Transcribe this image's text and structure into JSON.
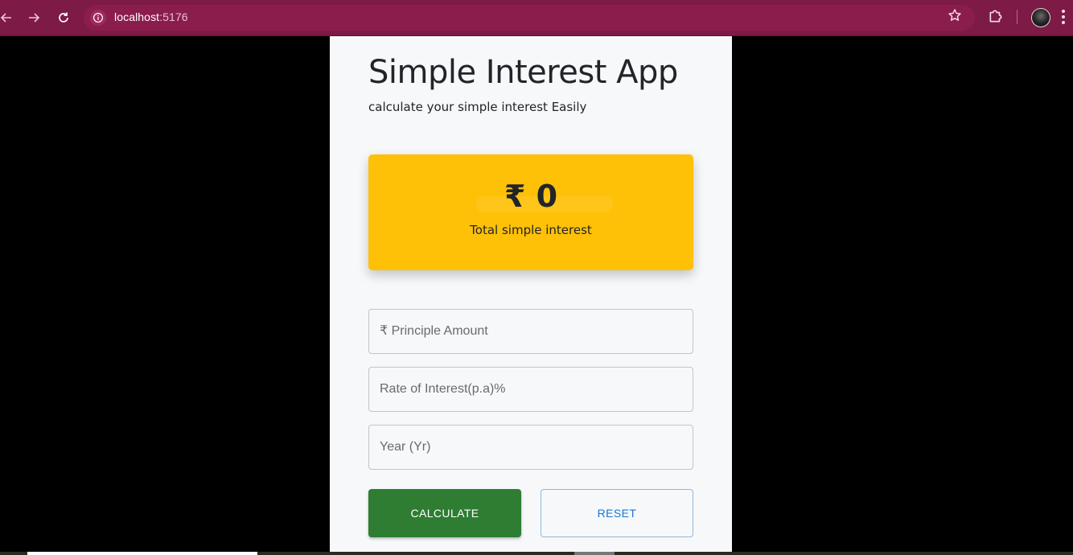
{
  "browser": {
    "url_host": "localhost",
    "url_port": ":5176"
  },
  "app": {
    "title": "Simple Interest App",
    "subtitle": "calculate your simple interest Easily",
    "result": {
      "amount": "₹ 0",
      "label": "Total simple interest",
      "accent_color": "#ffc107"
    },
    "fields": {
      "principle_placeholder": "₹ Principle Amount",
      "rate_placeholder": "Rate of Interest(p.a)%",
      "year_placeholder": "Year (Yr)"
    },
    "buttons": {
      "calculate_label": "CALCULATE",
      "reset_label": "RESET",
      "calculate_color": "#2e7d32",
      "reset_color": "#1976d2"
    }
  }
}
